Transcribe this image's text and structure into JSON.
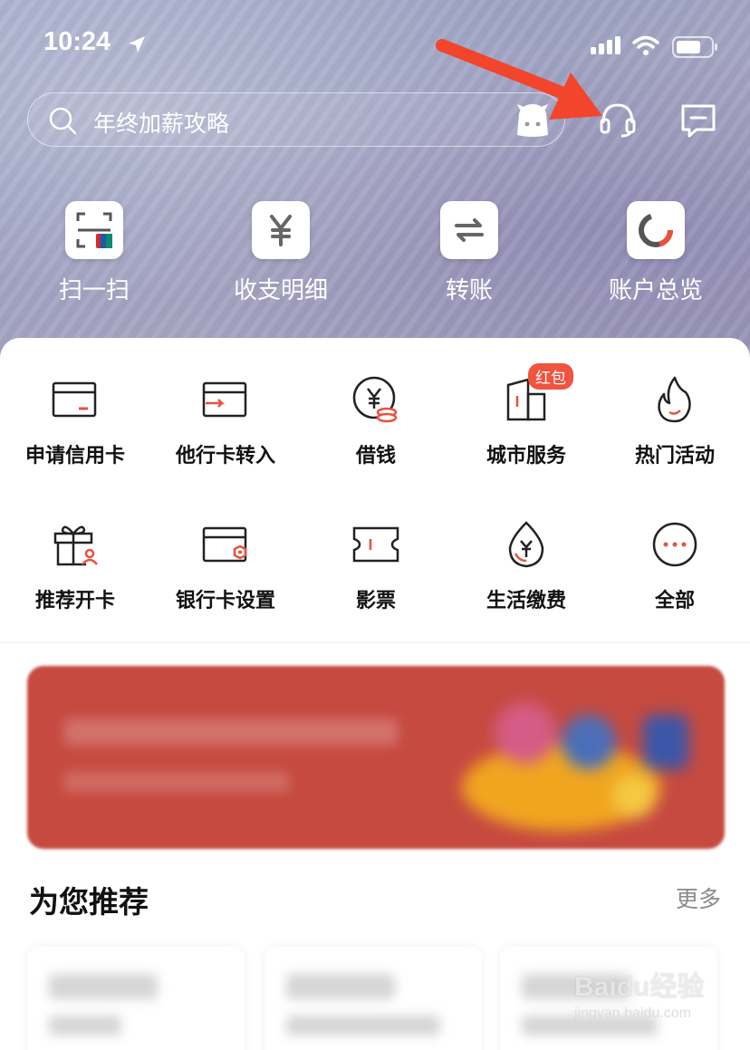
{
  "status_bar": {
    "time": "10:24"
  },
  "search": {
    "placeholder_text": "年终加薪攻略"
  },
  "quick_actions": [
    {
      "label": "扫一扫",
      "icon": "scan-icon"
    },
    {
      "label": "收支明细",
      "icon": "yuan-icon"
    },
    {
      "label": "转账",
      "icon": "transfer-icon"
    },
    {
      "label": "账户总览",
      "icon": "ring-chart-icon"
    }
  ],
  "services": [
    {
      "label": "申请信用卡",
      "icon": "credit-card-icon"
    },
    {
      "label": "他行卡转入",
      "icon": "card-transfer-in-icon"
    },
    {
      "label": "借钱",
      "icon": "loan-coin-icon"
    },
    {
      "label": "城市服务",
      "icon": "city-building-icon",
      "badge": "红包"
    },
    {
      "label": "热门活动",
      "icon": "flame-icon"
    },
    {
      "label": "推荐开卡",
      "icon": "gift-icon"
    },
    {
      "label": "银行卡设置",
      "icon": "card-settings-icon"
    },
    {
      "label": "影票",
      "icon": "ticket-icon"
    },
    {
      "label": "生活缴费",
      "icon": "water-drop-icon"
    },
    {
      "label": "全部",
      "icon": "more-dots-icon"
    }
  ],
  "recommend": {
    "title": "为您推荐",
    "more": "更多"
  },
  "watermark": {
    "brand": "Baidu经验",
    "url": "jingyan.baidu.com"
  },
  "colors": {
    "accent": "#f0533e",
    "banner": "#c64a40",
    "arrow": "#f2452c"
  }
}
